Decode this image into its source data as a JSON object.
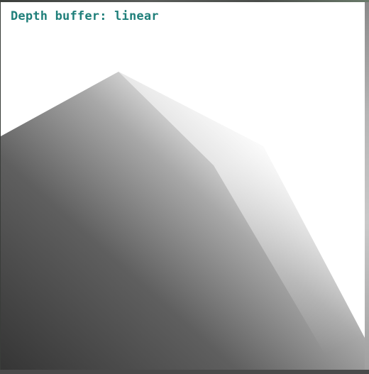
{
  "overlay": {
    "depth_label": "Depth buffer: linear"
  },
  "colors": {
    "label_text": "#1f7f7a",
    "background": "#ffffff",
    "near_depth_shade": "#3a3a3a",
    "far_depth_shade": "#ffffff"
  }
}
